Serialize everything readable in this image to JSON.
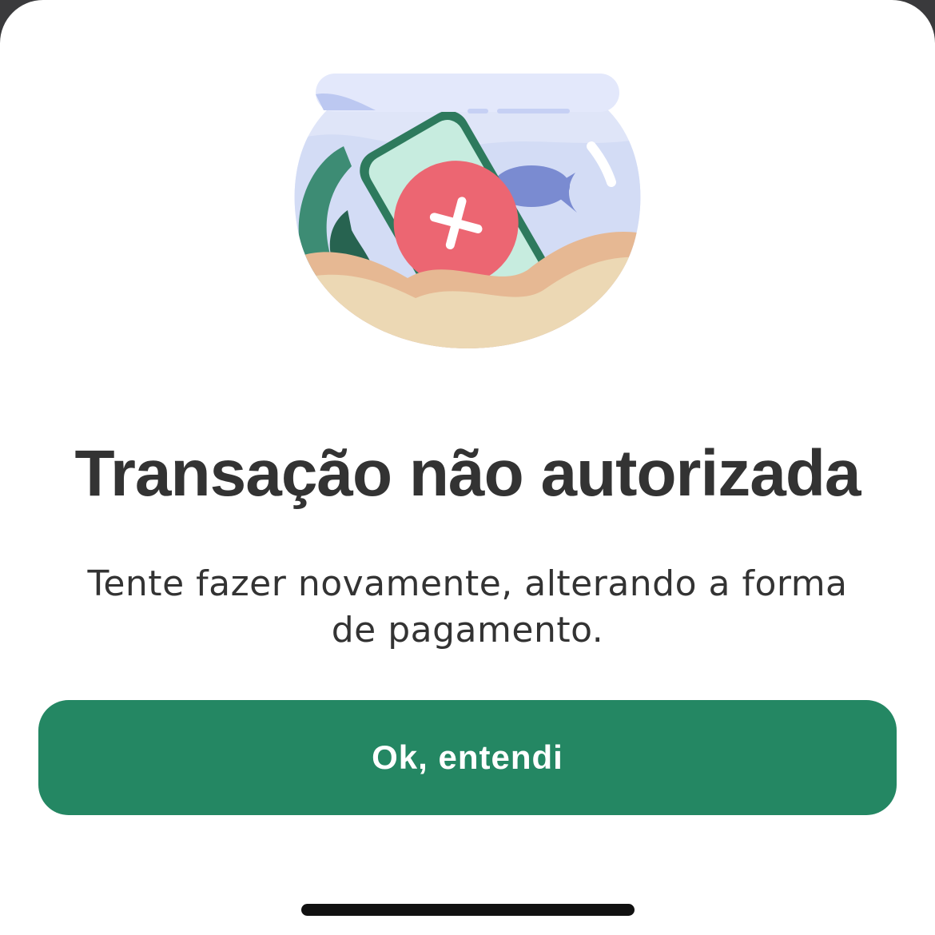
{
  "illustration": {
    "icon": "phone-in-fishbowl-error-icon",
    "error_color": "#ec6672"
  },
  "dialog": {
    "title": "Transação não autorizada",
    "message": "Tente fazer novamente, alterando a forma de pagamento.",
    "confirm_label": "Ok, entendi"
  },
  "colors": {
    "primary_button": "#248763",
    "title_text": "#333333"
  }
}
